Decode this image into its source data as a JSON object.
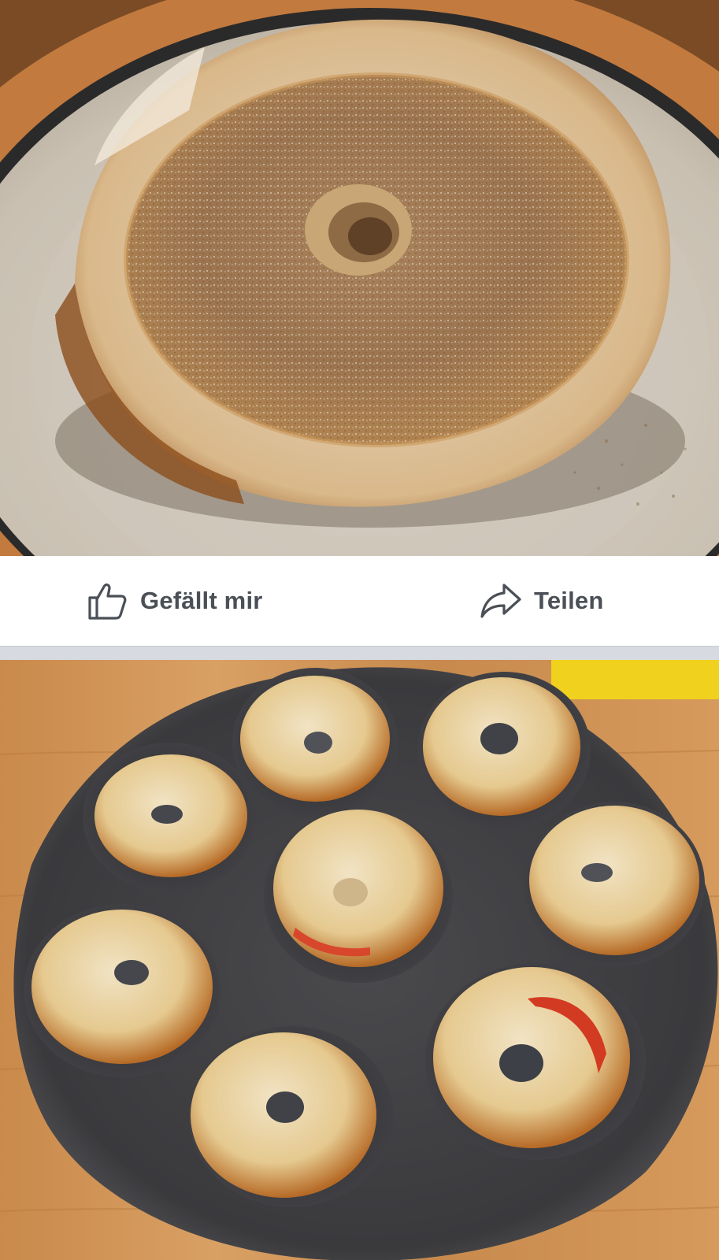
{
  "post": {
    "top_image": {
      "description_icon": "photo-apple-ring-cinnamon-sugar"
    },
    "actions": {
      "like": {
        "label": "Gefällt mir",
        "icon": "thumbs-up-icon"
      },
      "share": {
        "label": "Teilen",
        "icon": "share-arrow-icon"
      }
    },
    "bottom_image": {
      "description_icon": "photo-baked-apple-pastries-in-tray"
    }
  },
  "colors": {
    "action_text": "#4b4f56",
    "separator": "#d7dbe1",
    "background": "#ffffff"
  }
}
